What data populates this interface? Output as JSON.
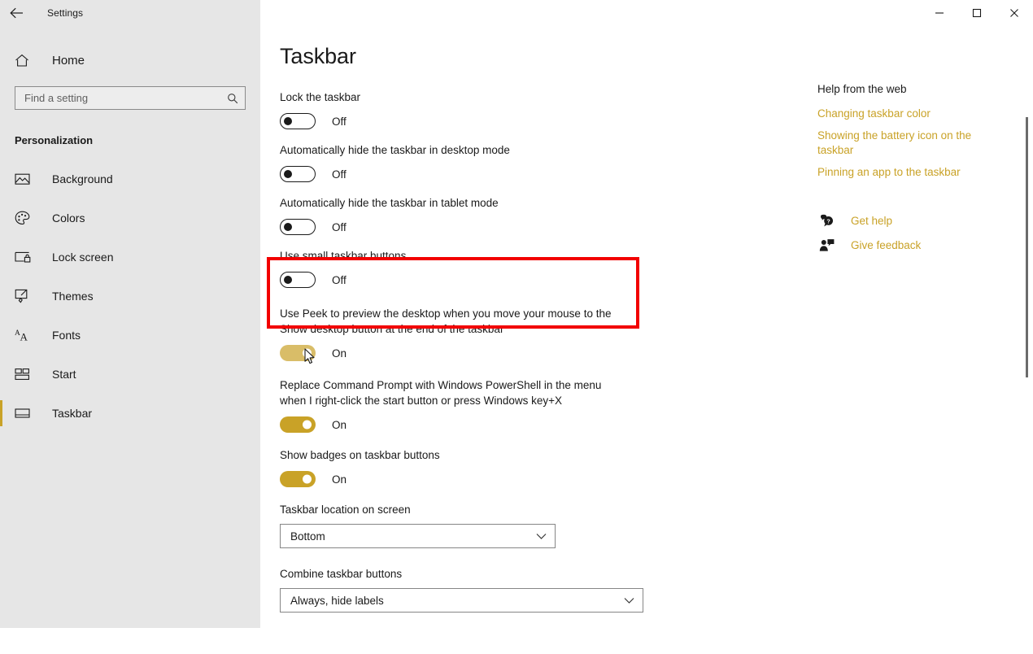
{
  "titlebar": {
    "back_icon": "back-arrow-icon",
    "app_title": "Settings",
    "minimize_icon": "minimize-icon",
    "maximize_icon": "maximize-icon",
    "close_icon": "close-icon"
  },
  "sidebar": {
    "home_label": "Home",
    "home_icon": "home-icon",
    "search": {
      "placeholder": "Find a setting",
      "value": "",
      "icon": "search-icon"
    },
    "section_header": "Personalization",
    "items": [
      {
        "label": "Background",
        "icon": "picture-icon",
        "selected": false
      },
      {
        "label": "Colors",
        "icon": "palette-icon",
        "selected": false
      },
      {
        "label": "Lock screen",
        "icon": "lock-screen-icon",
        "selected": false
      },
      {
        "label": "Themes",
        "icon": "paintbrush-icon",
        "selected": false
      },
      {
        "label": "Fonts",
        "icon": "fonts-icon",
        "selected": false
      },
      {
        "label": "Start",
        "icon": "start-tiles-icon",
        "selected": false
      },
      {
        "label": "Taskbar",
        "icon": "taskbar-icon",
        "selected": true
      }
    ]
  },
  "main": {
    "page_title": "Taskbar",
    "settings": [
      {
        "label": "Lock the taskbar",
        "state": "Off",
        "on": false,
        "hover": false
      },
      {
        "label": "Automatically hide the taskbar in desktop mode",
        "state": "Off",
        "on": false,
        "hover": false
      },
      {
        "label": "Automatically hide the taskbar in tablet mode",
        "state": "Off",
        "on": false,
        "hover": false
      },
      {
        "label": "Use small taskbar buttons",
        "state": "Off",
        "on": false,
        "hover": false
      },
      {
        "label": "Use Peek to preview the desktop when you move your mouse to the Show desktop button at the end of the taskbar",
        "state": "On",
        "on": true,
        "hover": true
      },
      {
        "label": "Replace Command Prompt with Windows PowerShell in the menu when I right-click the start button or press Windows key+X",
        "state": "On",
        "on": true,
        "hover": false
      },
      {
        "label": "Show badges on taskbar buttons",
        "state": "On",
        "on": true,
        "hover": false
      }
    ],
    "dropdowns": [
      {
        "label": "Taskbar location on screen",
        "value": "Bottom",
        "chevron": "chevron-down-icon"
      },
      {
        "label": "Combine taskbar buttons",
        "value": "Always, hide labels",
        "chevron": "chevron-down-icon"
      }
    ]
  },
  "help": {
    "title": "Help from the web",
    "links": [
      "Changing taskbar color",
      "Showing the battery icon on the taskbar",
      "Pinning an app to the taskbar"
    ],
    "actions": [
      {
        "label": "Get help",
        "icon": "get-help-icon"
      },
      {
        "label": "Give feedback",
        "icon": "give-feedback-icon"
      }
    ]
  },
  "colors": {
    "accent": "#c9a227",
    "accent_hover": "#d9bd68",
    "highlight": "#f20000",
    "sidebar_bg": "#e6e6e6",
    "content_bg": "#ffffff",
    "text": "#1a1a1a"
  }
}
